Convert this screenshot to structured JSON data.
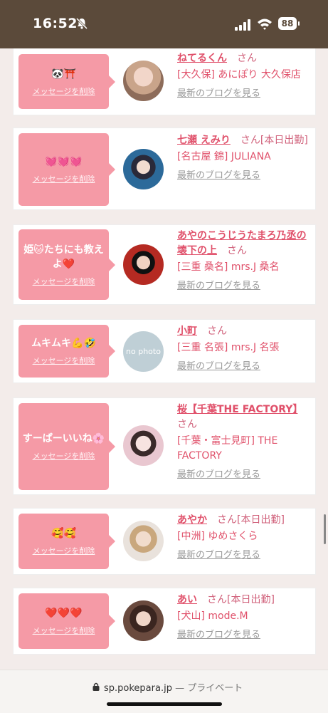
{
  "status_bar": {
    "time": "16:52",
    "battery": "88",
    "bell_icon": "bell-slash-icon",
    "signal_icon": "signal-icon",
    "wifi_icon": "wifi-icon"
  },
  "delete_label": "メッセージを削除",
  "blog_label": "最新のブログを見る",
  "cards": [
    {
      "message": "🐼⛩️",
      "name": "ねてるくん",
      "suffix": "さん",
      "shop": "[大久保] あにぽり 大久保店"
    },
    {
      "message": "💓💓💓",
      "name": "七瀬 えみり",
      "suffix": "さん[本日出勤]",
      "shop": "[名古屋 錦] JULIANA"
    },
    {
      "message": "姫🐱たちにも教えよ❤️",
      "name": "あやのこうじうたまろ乃丞の壊下の上",
      "suffix": "さん",
      "shop": "[三重 桑名] mrs.J 桑名"
    },
    {
      "message": "ムキムキ💪🤣",
      "name": "小町",
      "suffix": "さん",
      "shop": "[三重 名張] mrs.J 名張"
    },
    {
      "message": "すーぱーいいね🌸",
      "name": "桜【千葉THE FACTORY】",
      "suffix": "さん",
      "shop": "[千葉・富士見町] THE FACTORY"
    },
    {
      "message": "🥰🥰",
      "name": "あやか",
      "suffix": "さん[本日出勤]",
      "shop": "[中洲] ゆめさくら"
    },
    {
      "message": "❤️❤️❤️",
      "name": "あい",
      "suffix": "さん[本日出勤]",
      "shop": "[犬山] mode.M"
    }
  ],
  "no_photo_text": "no photo",
  "browser_bar": {
    "url": "sp.pokepara.jp",
    "separator": " — ",
    "private": "プライベート",
    "lock_icon": "lock-icon"
  },
  "colors": {
    "accent": "#e0506a",
    "bubble": "#f59aa6",
    "status_bar": "#5b4a3a"
  }
}
